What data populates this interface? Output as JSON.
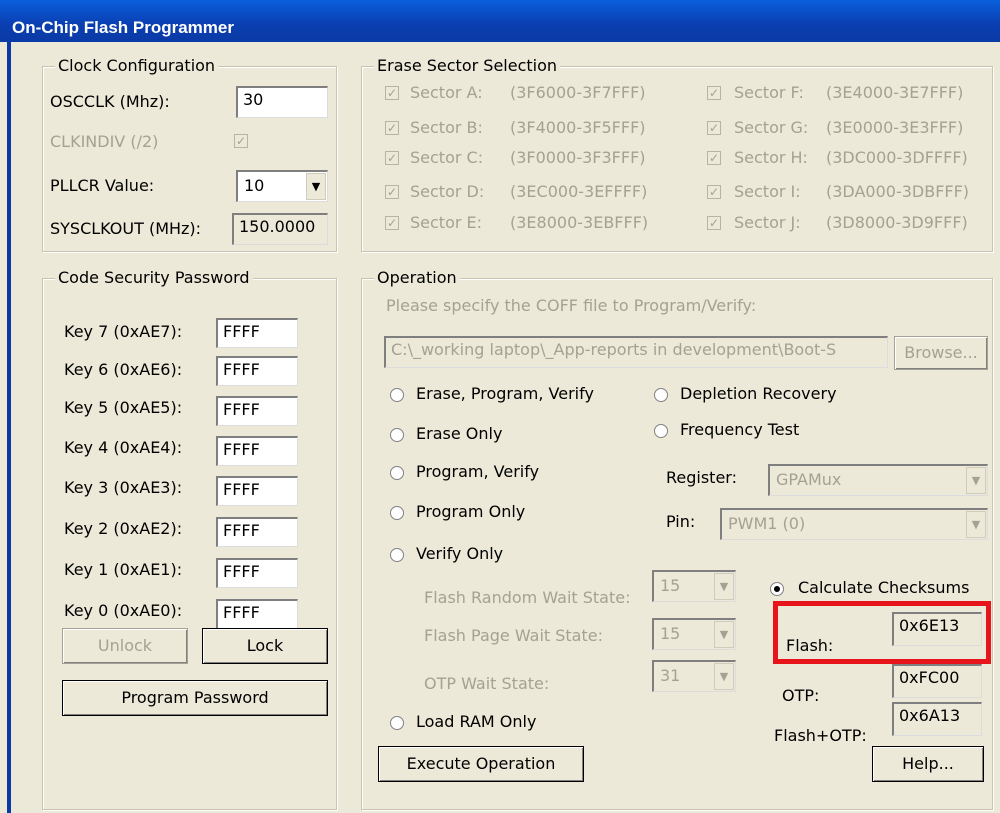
{
  "window": {
    "title": "On-Chip Flash Programmer"
  },
  "clock": {
    "legend": "Clock Configuration",
    "oscclk_label": "OSCCLK (Mhz):",
    "oscclk_value": "30",
    "clkindiv_label": "CLKINDIV (/2)",
    "pllcr_label": "PLLCR Value:",
    "pllcr_value": "10",
    "sysclkout_label": "SYSCLKOUT (MHz):",
    "sysclkout_value": "150.0000"
  },
  "erase": {
    "legend": "Erase Sector Selection",
    "sectors_left": [
      {
        "name": "Sector A:",
        "range": "(3F6000-3F7FFF)"
      },
      {
        "name": "Sector B:",
        "range": "(3F4000-3F5FFF)"
      },
      {
        "name": "Sector C:",
        "range": "(3F0000-3F3FFF)"
      },
      {
        "name": "Sector D:",
        "range": "(3EC000-3EFFFF)"
      },
      {
        "name": "Sector E:",
        "range": "(3E8000-3EBFFF)"
      }
    ],
    "sectors_right": [
      {
        "name": "Sector F:",
        "range": "(3E4000-3E7FFF)"
      },
      {
        "name": "Sector G:",
        "range": "(3E0000-3E3FFF)"
      },
      {
        "name": "Sector H:",
        "range": "(3DC000-3DFFFF)"
      },
      {
        "name": "Sector I:",
        "range": "(3DA000-3DBFFF)"
      },
      {
        "name": "Sector J:",
        "range": "(3D8000-3D9FFF)"
      }
    ]
  },
  "security": {
    "legend": "Code Security Password",
    "keys": [
      {
        "label": "Key 7 (0xAE7):",
        "value": "FFFF"
      },
      {
        "label": "Key 6 (0xAE6):",
        "value": "FFFF"
      },
      {
        "label": "Key 5 (0xAE5):",
        "value": "FFFF"
      },
      {
        "label": "Key 4 (0xAE4):",
        "value": "FFFF"
      },
      {
        "label": "Key 3 (0xAE3):",
        "value": "FFFF"
      },
      {
        "label": "Key 2 (0xAE2):",
        "value": "FFFF"
      },
      {
        "label": "Key 1 (0xAE1):",
        "value": "FFFF"
      },
      {
        "label": "Key 0 (0xAE0):",
        "value": "FFFF"
      }
    ],
    "unlock_label": "Unlock",
    "lock_label": "Lock",
    "program_password_label": "Program Password"
  },
  "operation": {
    "legend": "Operation",
    "coff_prompt": "Please specify the COFF file to Program/Verify:",
    "coff_path": "C:\\_working laptop\\_App-reports in development\\Boot-S",
    "browse_label": "Browse...",
    "radios": {
      "erase_program_verify": "Erase, Program, Verify",
      "erase_only": "Erase Only",
      "program_verify": "Program, Verify",
      "program_only": "Program Only",
      "verify_only": "Verify Only",
      "load_ram_only": "Load RAM Only",
      "depletion_recovery": "Depletion Recovery",
      "frequency_test": "Frequency Test",
      "calculate_checksums": "Calculate Checksums"
    },
    "register_label": "Register:",
    "register_value": "GPAMux",
    "pin_label": "Pin:",
    "pin_value": "PWM1 (0)",
    "flash_random_label": "Flash Random Wait State:",
    "flash_random_value": "15",
    "flash_page_label": "Flash Page Wait State:",
    "flash_page_value": "15",
    "otp_wait_label": "OTP Wait State:",
    "otp_wait_value": "31",
    "flash_label": "Flash:",
    "flash_value": "0x6E13",
    "otp_label": "OTP:",
    "otp_value": "0xFC00",
    "flash_otp_label": "Flash+OTP:",
    "flash_otp_value": "0x6A13",
    "execute_label": "Execute Operation",
    "help_label": "Help..."
  },
  "colors": {
    "highlight": "#e8141b",
    "titlebar": "#0a3eb0"
  }
}
